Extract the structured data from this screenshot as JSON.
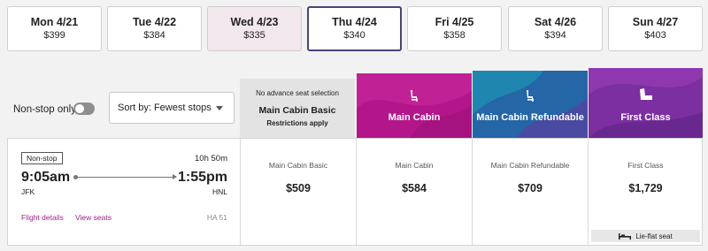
{
  "dates": [
    {
      "day": "Mon 4/21",
      "price": "$399",
      "state": "normal"
    },
    {
      "day": "Tue 4/22",
      "price": "$384",
      "state": "normal"
    },
    {
      "day": "Wed 4/23",
      "price": "$335",
      "state": "tinted"
    },
    {
      "day": "Thu 4/24",
      "price": "$340",
      "state": "selected"
    },
    {
      "day": "Fri 4/25",
      "price": "$358",
      "state": "normal"
    },
    {
      "day": "Sat 4/26",
      "price": "$394",
      "state": "normal"
    },
    {
      "day": "Sun 4/27",
      "price": "$403",
      "state": "normal"
    }
  ],
  "filters": {
    "nonstop_label": "Non-stop only",
    "nonstop_on": false,
    "sort_label": "Sort by: Fewest stops"
  },
  "fare_headers": {
    "basic": {
      "note": "No advance seat selection",
      "label": "Main Cabin Basic",
      "restriction": "Restrictions apply"
    },
    "main": {
      "label": "Main Cabin",
      "color": "#b3168a"
    },
    "refundable": {
      "label": "Main Cabin Refundable",
      "color": "#2466a6"
    },
    "first": {
      "label": "First Class",
      "color": "#7b2fa0"
    }
  },
  "flight": {
    "badge": "Non-stop",
    "duration": "10h 50m",
    "depart_time": "9:05am",
    "arrive_time": "1:55pm",
    "depart_airport": "JFK",
    "arrive_airport": "HNL",
    "details_link": "Flight details",
    "seats_link": "View seats",
    "flight_number": "HA 51",
    "fares": [
      {
        "name": "Main Cabin Basic",
        "price": "$509"
      },
      {
        "name": "Main Cabin",
        "price": "$584"
      },
      {
        "name": "Main Cabin Refundable",
        "price": "$709"
      },
      {
        "name": "First Class",
        "price": "$1,729",
        "feature": "Lie-flat seat"
      }
    ]
  },
  "icons": {
    "seat": "seat-icon",
    "lie_flat": "bed-icon",
    "sort_caret": "chevron-down-icon"
  }
}
